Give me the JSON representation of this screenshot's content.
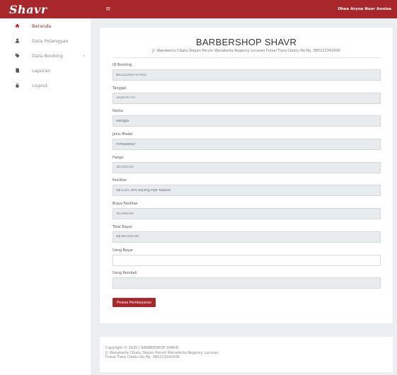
{
  "topbar": {
    "brand": "Shavr",
    "menu_icon": "≡",
    "user_name": "Dhea Aryna Noor Annisa"
  },
  "sidebar": {
    "items": [
      {
        "label": "Beranda",
        "icon": "home-icon"
      },
      {
        "label": "Data Pelanggan",
        "icon": "user-icon"
      },
      {
        "label": "Data Booking",
        "icon": "tag-icon"
      },
      {
        "label": "Laporan",
        "icon": "file-icon"
      },
      {
        "label": "Logout",
        "icon": "lock-icon"
      }
    ],
    "chevron": "›"
  },
  "header": {
    "title": "BARBERSHOP SHAVR",
    "address": "Jl. Wanakerta Cibatu Depan Perum Wanakerta Regency Lurusan Futsal Tiara Cibatu No.Hp. 085223342006"
  },
  "form": {
    "fields": [
      {
        "label": "ID Booking",
        "value": "B0220200707001",
        "placeholder": ""
      },
      {
        "label": "Tanggal",
        "value": "2020-07-07",
        "placeholder": ""
      },
      {
        "label": "Nama",
        "value": "Rangga",
        "placeholder": ""
      },
      {
        "label": "Jenis Model",
        "value": "Pompadour",
        "placeholder": ""
      },
      {
        "label": "Harga",
        "value": "30,000.00",
        "placeholder": ""
      },
      {
        "label": "Fasilitas",
        "value": "Rp.Cuci,Toni,Styling,Pijat Kepala",
        "placeholder": ""
      },
      {
        "label": "Biaya Fasilitas",
        "value": "50,000.00",
        "placeholder": ""
      },
      {
        "label": "Total Bayar",
        "value": "Rp.80,000.00",
        "placeholder": ""
      },
      {
        "label": "Uang Bayar",
        "value": "",
        "placeholder": ""
      },
      {
        "label": "Uang Kembali",
        "value": "",
        "placeholder": ""
      }
    ],
    "submit_label": "Proses Pembayaran"
  },
  "footer": {
    "copyright": "Copyright © 2020 | BARBERSHOP SHAVR",
    "line2": "Jl. Wanakerta Cibatu Depan Perum Wanakerta Regency Lurusan",
    "line3": "Futsal Tiara Cibatu No.Hp. 085223342006"
  },
  "colors": {
    "accent": "#a8272b",
    "background": "#eceef1",
    "input_readonly": "#e9ecef"
  }
}
